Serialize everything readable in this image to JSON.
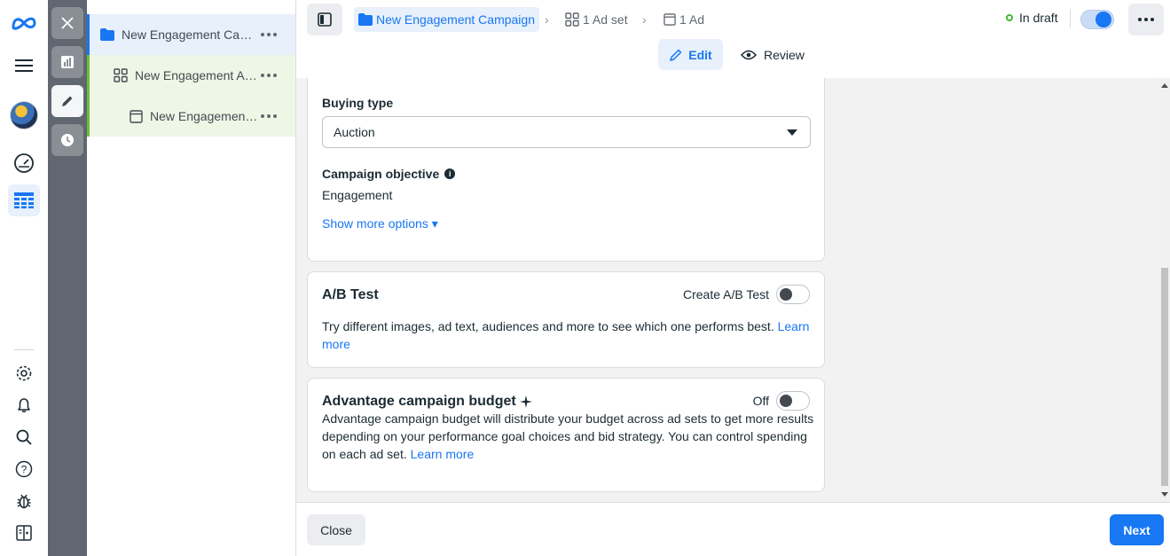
{
  "tree": {
    "campaign_label": "New Engagement Campaign",
    "adset_label": "New Engagement Ad set",
    "ad_label": "New Engagement Ad"
  },
  "header": {
    "crumb_campaign": "New Engagement Campaign",
    "crumb_adset": "1 Ad set",
    "crumb_ad": "1 Ad",
    "status": "In draft",
    "tab_edit": "Edit",
    "tab_review": "Review"
  },
  "campaign_card": {
    "buying_type_label": "Buying type",
    "buying_type_value": "Auction",
    "objective_label": "Campaign objective",
    "objective_value": "Engagement",
    "show_more": "Show more options ▾"
  },
  "ab_test": {
    "title": "A/B Test",
    "toggle_label": "Create A/B Test",
    "description": "Try different images, ad text, audiences and more to see which one performs best.",
    "learn_more": "Learn more"
  },
  "advantage_budget": {
    "title": "Advantage campaign budget",
    "toggle_label": "Off",
    "description": "Advantage campaign budget will distribute your budget across ad sets to get more results depending on your performance goal choices and bid strategy. You can control spending on each ad set.",
    "learn_more": "Learn more"
  },
  "footer": {
    "close_label": "Close",
    "next_label": "Next"
  },
  "colors": {
    "accent": "#1877f2",
    "draft_green": "#42b72a"
  }
}
